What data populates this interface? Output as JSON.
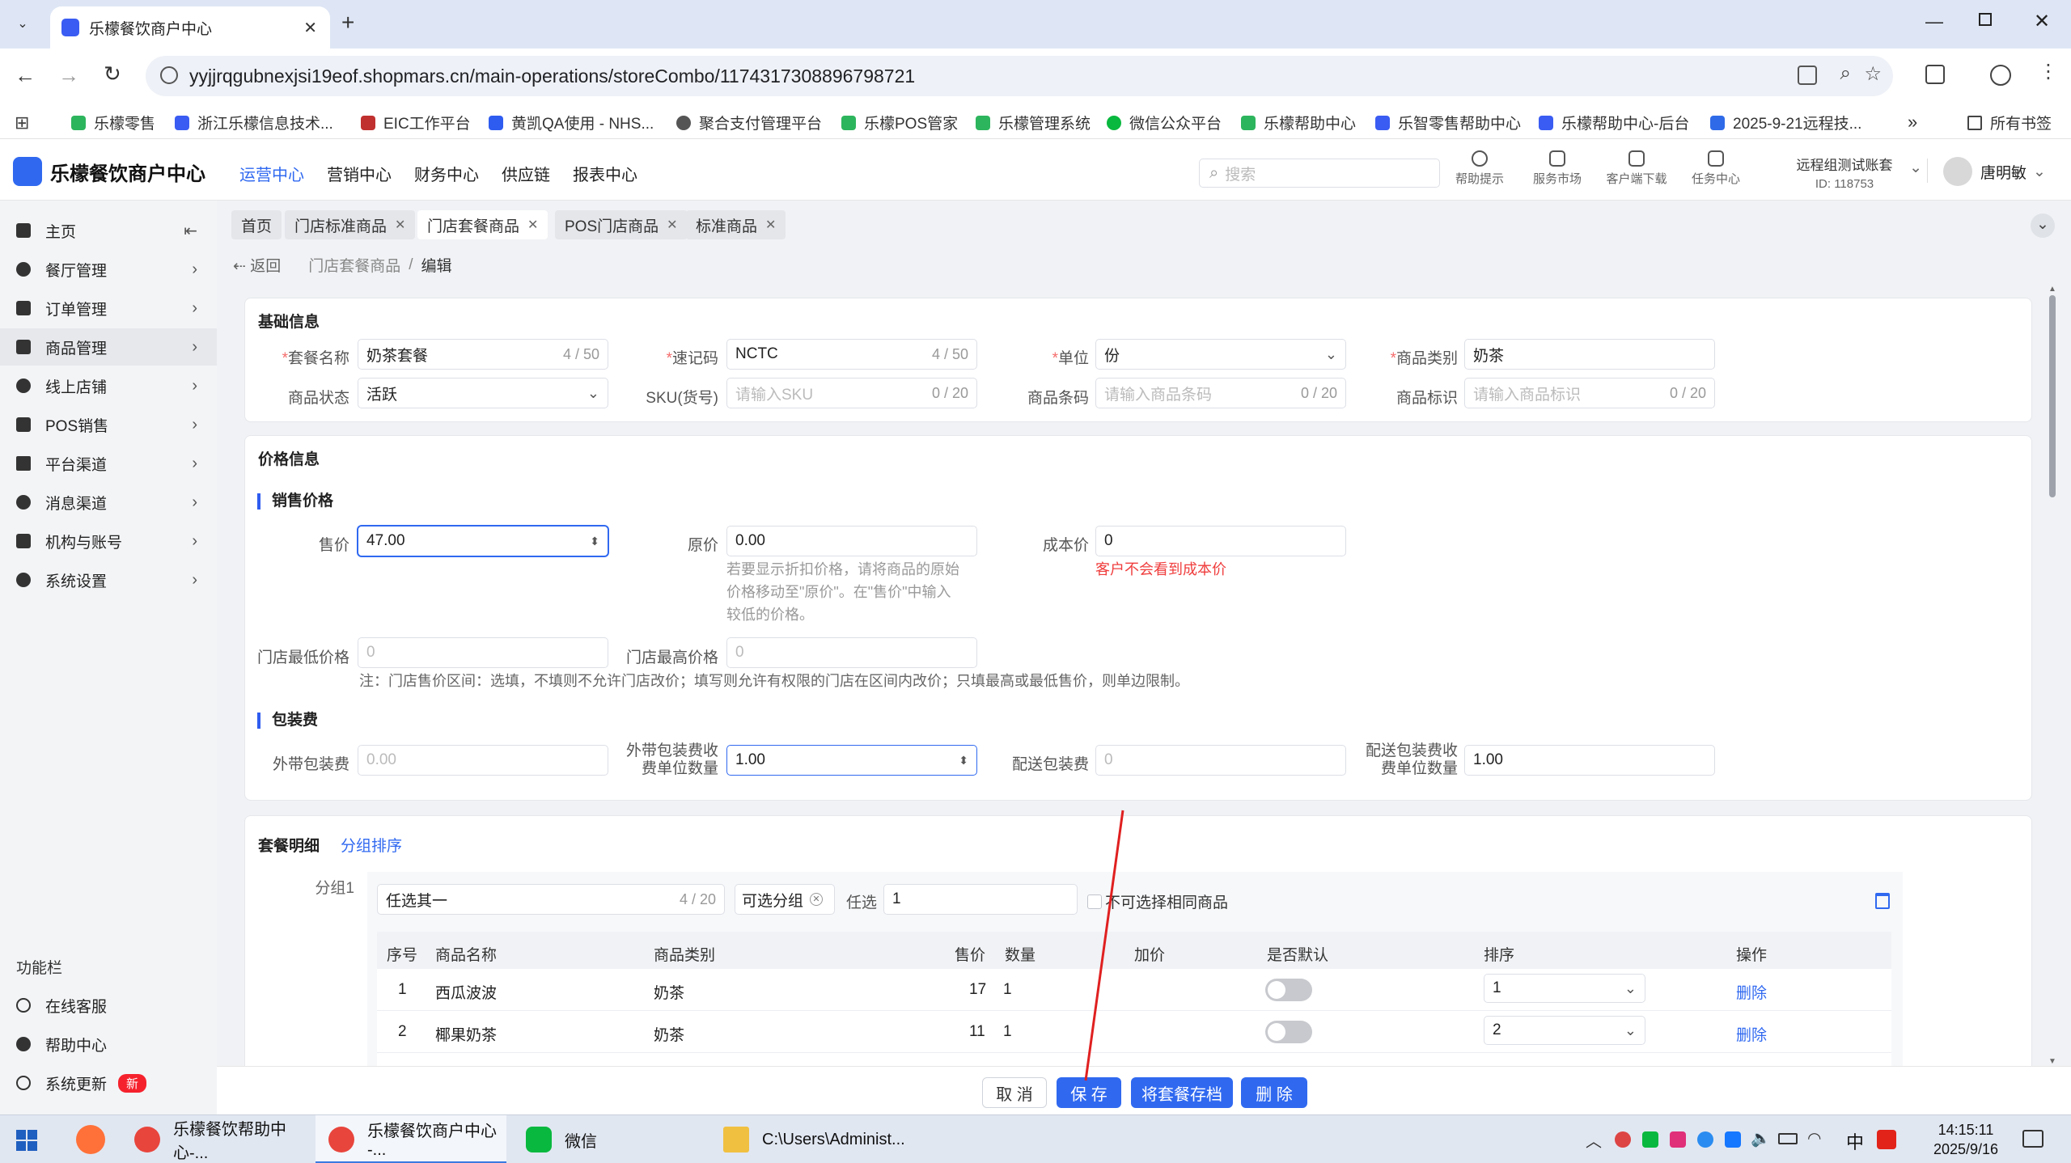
{
  "browser": {
    "tabs": [
      {
        "title": "乐檬餐饮商户中心"
      }
    ],
    "url": "yyjjrqgubnexjsi19eof.shopmars.cn/main-operations/storeCombo/1174317308896798721",
    "bookmarks": [
      "乐檬零售",
      "浙江乐檬信息技术...",
      "EIC工作平台",
      "黄凯QA使用 - NHS...",
      "聚合支付管理平台",
      "乐檬POS管家",
      "乐檬管理系统",
      "微信公众平台",
      "乐檬帮助中心",
      "乐智零售帮助中心",
      "乐檬帮助中心-后台",
      "2025-9-21远程技...",
      "所有书签"
    ],
    "bookmark_more": "»"
  },
  "app": {
    "logo": "乐檬餐饮商户中心",
    "nav": [
      "运营中心",
      "营销中心",
      "财务中心",
      "供应链",
      "报表中心"
    ],
    "search_placeholder": "搜索",
    "header_icons": [
      "帮助提示",
      "服务市场",
      "客户端下载",
      "任务中心"
    ],
    "account_name": "远程组测试账套",
    "account_id": "ID: 118753",
    "user_name": "唐明敏"
  },
  "sidebar": {
    "items": [
      "主页",
      "餐厅管理",
      "订单管理",
      "商品管理",
      "线上店铺",
      "POS销售",
      "平台渠道",
      "消息渠道",
      "机构与账号",
      "系统设置"
    ],
    "function_title": "功能栏",
    "function_items": [
      "在线客服",
      "帮助中心",
      "系统更新"
    ],
    "new_badge": "新"
  },
  "page_tabs": [
    "首页",
    "门店标准商品",
    "门店套餐商品",
    "POS门店商品",
    "标准商品"
  ],
  "breadcrumb": {
    "back": "返回",
    "parent": "门店套餐商品",
    "sep": "/",
    "current": "编辑"
  },
  "basic": {
    "title": "基础信息",
    "name_label": "套餐名称",
    "name_value": "奶茶套餐",
    "name_count": "4 / 50",
    "code_label": "速记码",
    "code_value": "NCTC",
    "code_count": "4 / 50",
    "unit_label": "单位",
    "unit_value": "份",
    "category_label": "商品类别",
    "category_value": "奶茶",
    "status_label": "商品状态",
    "status_value": "活跃",
    "sku_label": "SKU(货号)",
    "sku_placeholder": "请输入SKU",
    "sku_count": "0 / 20",
    "barcode_label": "商品条码",
    "barcode_placeholder": "请输入商品条码",
    "barcode_count": "0 / 20",
    "tag_label": "商品标识",
    "tag_placeholder": "请输入商品标识",
    "tag_count": "0 / 20"
  },
  "price": {
    "title": "价格信息",
    "sale_section": "销售价格",
    "sale_label": "售价",
    "sale_value": "47.00",
    "orig_label": "原价",
    "orig_value": "0.00",
    "orig_hint": [
      "若要显示折扣价格，请将商品的原始",
      "价格移动至\"原价\"。在\"售价\"中输入",
      "较低的价格。"
    ],
    "cost_label": "成本价",
    "cost_value": "0",
    "cost_hint": "客户不会看到成本价",
    "min_label": "门店最低价格",
    "min_placeholder": "0",
    "max_label": "门店最高价格",
    "max_placeholder": "0",
    "range_note": "注：门店售价区间：选填，不填则不允许门店改价；填写则允许有权限的门店在区间内改价；只填最高或最低售价，则单边限制。",
    "pack_section": "包装费",
    "takeout_label": "外带包装费",
    "takeout_placeholder": "0.00",
    "takeout_unit_label": [
      "外带包装费收",
      "费单位数量"
    ],
    "takeout_unit_value": "1.00",
    "delivery_label": "配送包装费",
    "delivery_placeholder": "0",
    "delivery_unit_label": [
      "配送包装费收",
      "费单位数量"
    ],
    "delivery_unit_value": "1.00"
  },
  "combo": {
    "title": "套餐明细",
    "sort_link": "分组排序",
    "group_label": "分组1",
    "group_name": "任选其一",
    "group_count": "4 / 20",
    "group_type": "可选分组",
    "choose_label": "任选",
    "choose_value": "1",
    "no_same_label": "不可选择相同商品",
    "columns": [
      "序号",
      "商品名称",
      "商品类别",
      "售价",
      "数量",
      "加价",
      "是否默认",
      "排序",
      "操作"
    ],
    "rows": [
      {
        "no": "1",
        "name": "西瓜波波",
        "category": "奶茶",
        "price": "17",
        "qty": "1",
        "sort": "1",
        "action": "删除"
      },
      {
        "no": "2",
        "name": "椰果奶茶",
        "category": "奶茶",
        "price": "11",
        "qty": "1",
        "sort": "2",
        "action": "删除"
      }
    ]
  },
  "footer": {
    "cancel": "取 消",
    "save": "保 存",
    "archive": "将套餐存档",
    "delete": "删 除"
  },
  "taskbar": {
    "items": [
      "乐檬餐饮帮助中心-...",
      "乐檬餐饮商户中心 -...",
      "微信",
      "C:\\Users\\Administ..."
    ],
    "ime": "中",
    "time": "14:15:11",
    "date": "2025/9/16"
  },
  "colors": {
    "primary": "#3069f0",
    "danger": "#f56c6c",
    "chrome_bg": "#dee6f5"
  }
}
